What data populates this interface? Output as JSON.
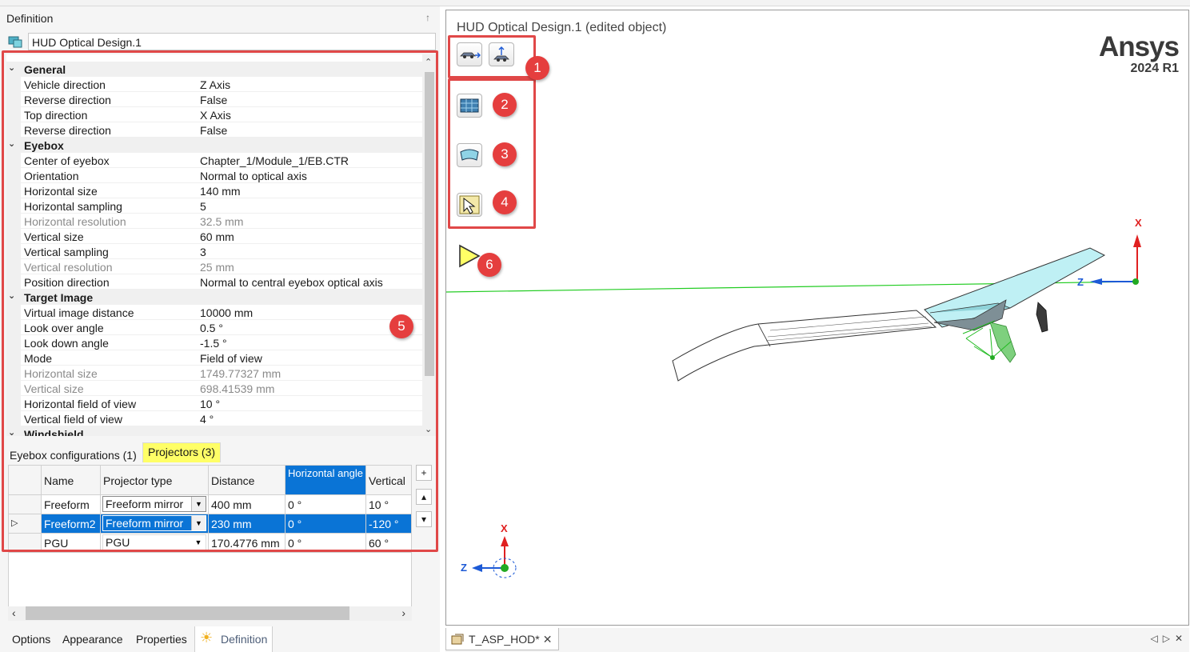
{
  "panel": {
    "header": "Definition",
    "pin": "↑",
    "object_name": "HUD Optical Design.1"
  },
  "properties": {
    "general": {
      "title": "General",
      "vehicle_direction_label": "Vehicle direction",
      "vehicle_direction": "Z Axis",
      "reverse_direction_label": "Reverse direction",
      "reverse_direction": "False",
      "top_direction_label": "Top direction",
      "top_direction": "X Axis",
      "reverse_direction2_label": "Reverse direction",
      "reverse_direction2": "False"
    },
    "eyebox": {
      "title": "Eyebox",
      "center_label": "Center of eyebox",
      "center": "Chapter_1/Module_1/EB.CTR",
      "orientation_label": "Orientation",
      "orientation": "Normal to optical axis",
      "h_size_label": "Horizontal size",
      "h_size": "140 mm",
      "h_sampling_label": "Horizontal sampling",
      "h_sampling": "5",
      "h_resolution_label": "Horizontal resolution",
      "h_resolution": "32.5 mm",
      "v_size_label": "Vertical size",
      "v_size": "60 mm",
      "v_sampling_label": "Vertical sampling",
      "v_sampling": "3",
      "v_resolution_label": "Vertical resolution",
      "v_resolution": "25 mm",
      "position_direction_label": "Position direction",
      "position_direction": "Normal to central eyebox optical axis"
    },
    "target_image": {
      "title": "Target Image",
      "vid_label": "Virtual image distance",
      "vid": "10000 mm",
      "look_over_label": "Look over angle",
      "look_over": "0.5 °",
      "look_down_label": "Look down angle",
      "look_down": "-1.5 °",
      "mode_label": "Mode",
      "mode": "Field of view",
      "h_size_label": "Horizontal size",
      "h_size": "1749.77327 mm",
      "v_size_label": "Vertical size",
      "v_size": "698.41539 mm",
      "h_fov_label": "Horizontal field of view",
      "h_fov": "10 °",
      "v_fov_label": "Vertical field of view",
      "v_fov": "4 °"
    },
    "windshield": {
      "title": "Windshield"
    }
  },
  "tabs": {
    "eyebox_configs": "Eyebox configurations (1)",
    "projectors": "Projectors (3)"
  },
  "projectors_table": {
    "headers": {
      "name": "Name",
      "type": "Projector type",
      "distance": "Distance",
      "h_angle": "Horizontal angle",
      "vertical": "Vertical"
    },
    "rows": [
      {
        "name": "Freeform",
        "type": "Freeform mirror",
        "distance": "400 mm",
        "h_angle": "0 °",
        "vertical": "10 °"
      },
      {
        "name": "Freeform2",
        "type": "Freeform mirror",
        "distance": "230 mm",
        "h_angle": "0 °",
        "vertical": "-120 °"
      },
      {
        "name": "PGU",
        "type": "PGU",
        "distance": "170.4776 mm",
        "h_angle": "0 °",
        "vertical": "60 °"
      }
    ],
    "add_btn": "+",
    "up_btn": "▴",
    "down_btn": "▾"
  },
  "bottom_tabs": {
    "options": "Options",
    "appearance": "Appearance",
    "properties": "Properties",
    "definition": "Definition"
  },
  "viewport": {
    "title": "HUD Optical Design.1 (edited object)",
    "brand": "Ansys",
    "version": "2024 R1",
    "axis_x": "X",
    "axis_z": "Z",
    "tab_label": "T_ASP_HOD*",
    "tab_close": "✕"
  },
  "annotations": [
    "1",
    "2",
    "3",
    "4",
    "5",
    "6"
  ],
  "colors": {
    "selection": "#0a74d6",
    "highlight": "#ffff66",
    "annotation": "#e53e3e"
  }
}
